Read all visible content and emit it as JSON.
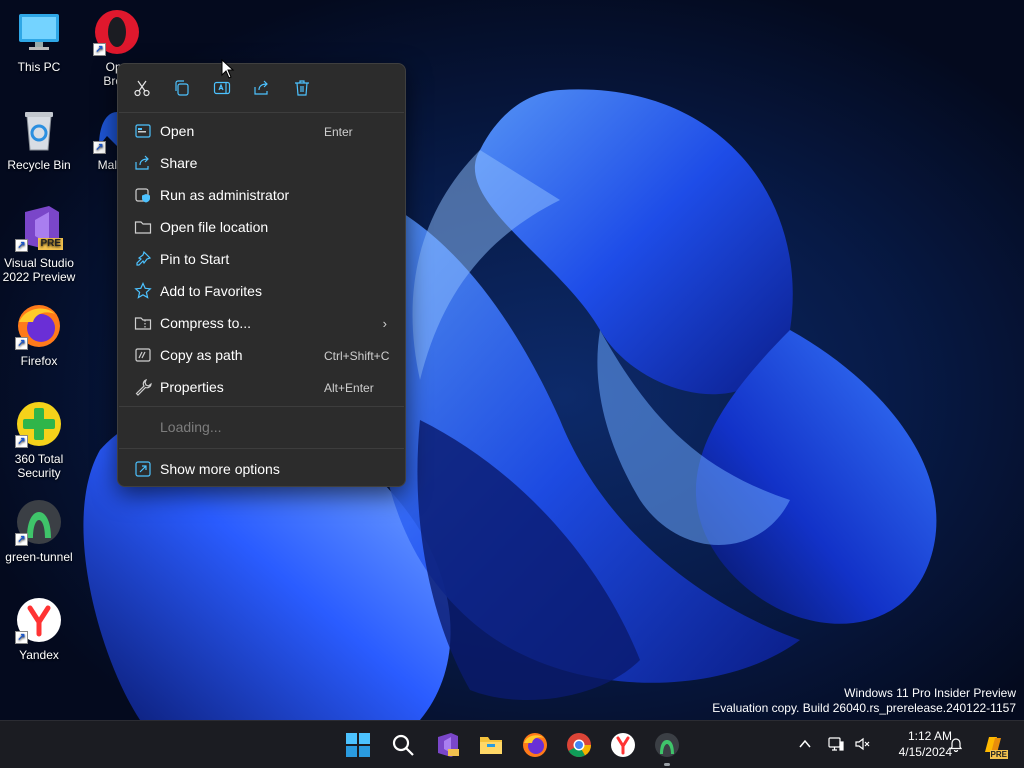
{
  "desktop": {
    "icons": [
      {
        "label": "This PC",
        "icon": "monitor-icon",
        "shortcut": false
      },
      {
        "label": "Recycle Bin",
        "icon": "recycle-bin-icon",
        "shortcut": false
      },
      {
        "label": "Visual Studio 2022 Preview",
        "icon": "visual-studio-icon",
        "badge": "PRE",
        "shortcut": true
      },
      {
        "label": "Firefox",
        "icon": "firefox-icon",
        "shortcut": true
      },
      {
        "label": "360 Total Security",
        "icon": "360-security-icon",
        "shortcut": true
      },
      {
        "label": "green-tunnel",
        "icon": "green-tunnel-icon",
        "shortcut": true
      },
      {
        "label": "Yandex",
        "icon": "yandex-icon",
        "shortcut": true
      },
      {
        "label": "Opera Browser",
        "label_visible": [
          "Ope",
          "Brow"
        ],
        "icon": "opera-icon",
        "shortcut": true
      },
      {
        "label": "Malwarebytes",
        "label_visible": [
          "Malwar"
        ],
        "icon": "malwarebytes-icon",
        "shortcut": true
      }
    ]
  },
  "context_menu": {
    "quick_actions": [
      {
        "name": "cut",
        "icon": "scissors-icon"
      },
      {
        "name": "copy",
        "icon": "copy-icon"
      },
      {
        "name": "rename",
        "icon": "rename-icon"
      },
      {
        "name": "share",
        "icon": "share-icon"
      },
      {
        "name": "delete",
        "icon": "trash-icon"
      }
    ],
    "items": [
      {
        "label": "Open",
        "shortcut": "Enter",
        "icon": "open-icon"
      },
      {
        "label": "Share",
        "shortcut": "",
        "icon": "share-icon"
      },
      {
        "label": "Run as administrator",
        "shortcut": "",
        "icon": "shield-admin-icon"
      },
      {
        "label": "Open file location",
        "shortcut": "",
        "icon": "folder-icon"
      },
      {
        "label": "Pin to Start",
        "shortcut": "",
        "icon": "pin-icon"
      },
      {
        "label": "Add to Favorites",
        "shortcut": "",
        "icon": "star-icon"
      },
      {
        "label": "Compress to...",
        "shortcut": "",
        "icon": "zip-folder-icon",
        "submenu": true
      },
      {
        "label": "Copy as path",
        "shortcut": "Ctrl+Shift+C",
        "icon": "path-icon"
      },
      {
        "label": "Properties",
        "shortcut": "Alt+Enter",
        "icon": "wrench-icon"
      }
    ],
    "loading_text": "Loading...",
    "show_more": {
      "label": "Show more options",
      "icon": "show-more-icon"
    }
  },
  "watermark": {
    "line1": "Windows 11 Pro Insider Preview",
    "line2": "Evaluation copy. Build 26040.rs_prerelease.240122-1157"
  },
  "taskbar": {
    "apps": [
      {
        "name": "start",
        "icon": "windows-start-icon"
      },
      {
        "name": "search",
        "icon": "search-icon"
      },
      {
        "name": "visual-studio",
        "icon": "visual-studio-icon"
      },
      {
        "name": "file-explorer",
        "icon": "folder-icon"
      },
      {
        "name": "firefox",
        "icon": "firefox-icon"
      },
      {
        "name": "chrome",
        "icon": "chrome-icon"
      },
      {
        "name": "yandex",
        "icon": "yandex-icon"
      },
      {
        "name": "green-tunnel",
        "icon": "green-tunnel-icon"
      }
    ],
    "tray": [
      {
        "name": "show-hidden-icons",
        "icon": "chevron-up-icon"
      },
      {
        "name": "network",
        "icon": "network-icon"
      },
      {
        "name": "volume",
        "icon": "volume-muted-icon"
      }
    ],
    "clock": {
      "time": "1:12 AM",
      "date": "4/15/2024"
    },
    "notifications_icon": "bell-icon",
    "copilot_badge": "PRE"
  },
  "colors": {
    "menu_bg": "#2c2c2c",
    "taskbar_bg": "#1b1c22",
    "accent": "#4cc2ff",
    "desktop_bg": "#050d24"
  }
}
